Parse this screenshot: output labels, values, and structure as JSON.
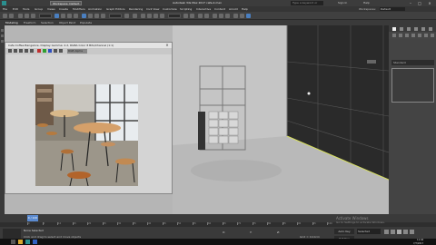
{
  "titlebar": {
    "workspace": "Workspace: Default",
    "title": "Autodesk 3ds Max 2017   cafe-2.max",
    "search": "Type a keyword or phrase",
    "signin": "Sign In",
    "help": "Help"
  },
  "menubar": {
    "items": [
      "File",
      "Edit",
      "Tools",
      "Group",
      "Views",
      "Create",
      "Modifiers",
      "Animation",
      "Graph Editors",
      "Rendering",
      "Civil View",
      "Customize",
      "Scripting",
      "Interactive",
      "Content",
      "Arnold",
      "Help"
    ],
    "workspace_label": "Workspaces:",
    "workspace_value": "Default"
  },
  "ribbon": {
    "tabs": [
      "Modeling",
      "Freeform",
      "Selection",
      "Object Paint",
      "Populate"
    ]
  },
  "framewindow": {
    "title": "Cafe Coffee Bangalore, Display Gamma: 2.2, RGBA Color 8 Bits/Channel (1:1)",
    "channel": "RGB Alpha"
  },
  "commandpanel": {
    "name_placeholder": "Standard"
  },
  "timeline": {
    "frame": "0 / 100"
  },
  "trackbar": {
    "ticks": [
      "0",
      "5",
      "10",
      "15",
      "20",
      "25",
      "30",
      "35",
      "40",
      "45",
      "50",
      "55",
      "60",
      "65",
      "70",
      "75",
      "80",
      "85",
      "90",
      "95",
      "100"
    ]
  },
  "status": {
    "line1": "None Selected",
    "line2": "Click and drag to select and move objects",
    "x_label": "X:",
    "y_label": "Y:",
    "z_label": "Z:",
    "grid": "Grid = 10.0cm",
    "autokey": "Auto Key",
    "setkey": "Set Key",
    "selected": "Selected",
    "addtime": "Add Time Tag"
  },
  "watermark": {
    "line1": "Activate Windows",
    "line2": "Go to Settings to activate Windows."
  },
  "taskbar": {
    "time": "11:40",
    "date": "7/7/2017"
  },
  "colors": {
    "accent": "#5a8ad0",
    "viewport_bg": "#c8c8c8",
    "ui_dark": "#3a3a3a"
  }
}
